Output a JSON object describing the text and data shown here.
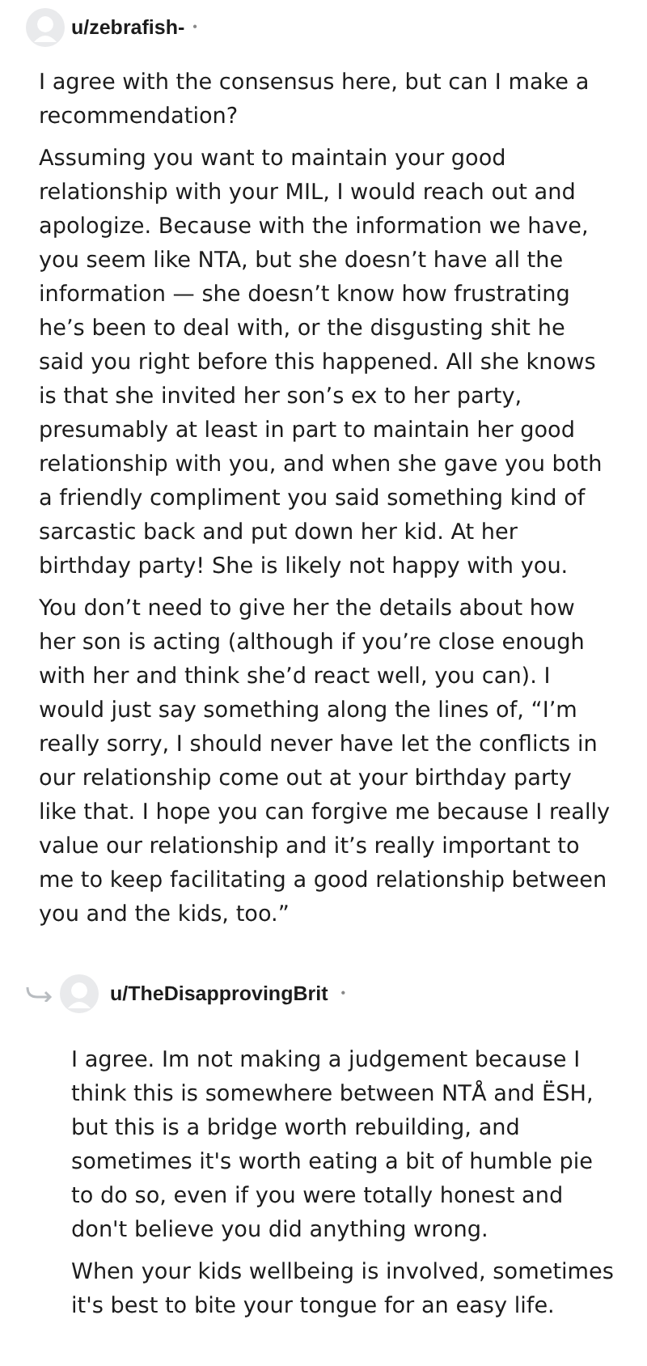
{
  "comments": [
    {
      "author": "u/zebrafish-",
      "separator": "•",
      "is_reply": false,
      "paragraphs": [
        "I agree with the consensus here, but can I make a recommendation?",
        "Assuming you want to maintain your good relationship with your MIL, I would reach out and apologize. Because with the information we have, you seem like NTA, but she doesn’t have all the information — she doesn’t know how frustrating he’s been to deal with, or the disgusting shit he said you right before this happened. All she knows is that she invited her son’s ex to her party, presumably at least in part to maintain her good relationship with you, and when she gave you both a friendly compliment you said something kind of sarcastic back and put down her kid. At her birthday party! She is likely not happy with you.",
        "You don’t need to give her the details about how her son is acting (although if you’re close enough with her and think she’d react well, you can). I would just say something along the lines of, “I’m really sorry, I should never have let the conflicts in our relationship come out at your birthday party like that. I hope you can forgive me because I really value our relationship and it’s really important to me to keep facilitating a good relationship between you and the kids, too.”"
      ]
    },
    {
      "author": "u/TheDisapprovingBrit",
      "separator": "•",
      "is_reply": true,
      "paragraphs": [
        "I agree. Im not making a judgement because I think this is somewhere between NTÅ and ËSH, but this is a bridge worth rebuilding, and sometimes it's worth eating a bit of humble pie to do so, even if you were totally honest and don't believe you did anything wrong.",
        "When your kids wellbeing is involved, sometimes it's best to bite your tongue for an easy life."
      ]
    }
  ]
}
